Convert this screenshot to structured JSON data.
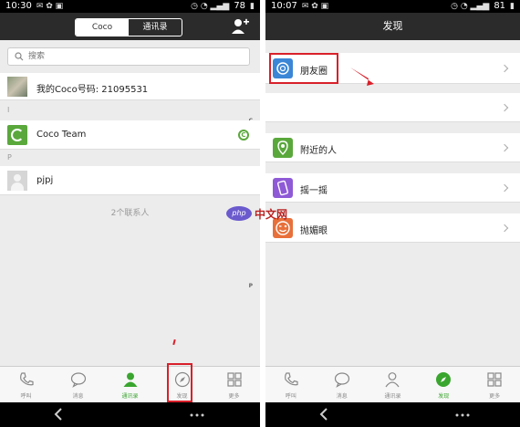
{
  "left": {
    "status": {
      "time": "10:30",
      "battery": "78"
    },
    "segments": [
      "Coco",
      "通讯录"
    ],
    "search": {
      "placeholder": "搜索"
    },
    "my_number": "我的Coco号码: 21095531",
    "section_a_letter": "I",
    "index_letters": [
      "C",
      "P"
    ],
    "coco_team": "Coco Team",
    "section_p_letter": "P",
    "pjpj": "pjpj",
    "count": "2个联系人",
    "tabs": [
      {
        "label": "呼叫",
        "icon": "phone-icon"
      },
      {
        "label": "消息",
        "icon": "chat-bubble-icon"
      },
      {
        "label": "通讯录",
        "icon": "contacts-person-icon",
        "active": true
      },
      {
        "label": "发现",
        "icon": "compass-icon"
      },
      {
        "label": "更多",
        "icon": "grid-more-icon"
      }
    ]
  },
  "right": {
    "status": {
      "time": "10:07",
      "battery": "81"
    },
    "title": "发现",
    "items": [
      {
        "label": "朋友圈",
        "icon": "moments-icon",
        "color": "#3b86d6"
      },
      {
        "label": "",
        "icon": "",
        "color": ""
      },
      {
        "label": "附近的人",
        "icon": "location-pin-icon",
        "color": "#5aa83c"
      },
      {
        "label": "摇一摇",
        "icon": "shake-phone-icon",
        "color": "#8f5ad6"
      },
      {
        "label": "抛媚眼",
        "icon": "wink-icon",
        "color": "#e8703a"
      }
    ],
    "tabs": [
      {
        "label": "呼叫",
        "icon": "phone-icon"
      },
      {
        "label": "消息",
        "icon": "chat-bubble-icon"
      },
      {
        "label": "通讯录",
        "icon": "contacts-person-icon"
      },
      {
        "label": "发现",
        "icon": "compass-icon",
        "active": true
      },
      {
        "label": "更多",
        "icon": "grid-more-icon"
      }
    ]
  },
  "watermark": {
    "logo": "php",
    "text": "中文网"
  },
  "colors": {
    "accent": "#3aa52f",
    "highlight": "#d8202a",
    "header": "#2b2b2b"
  }
}
